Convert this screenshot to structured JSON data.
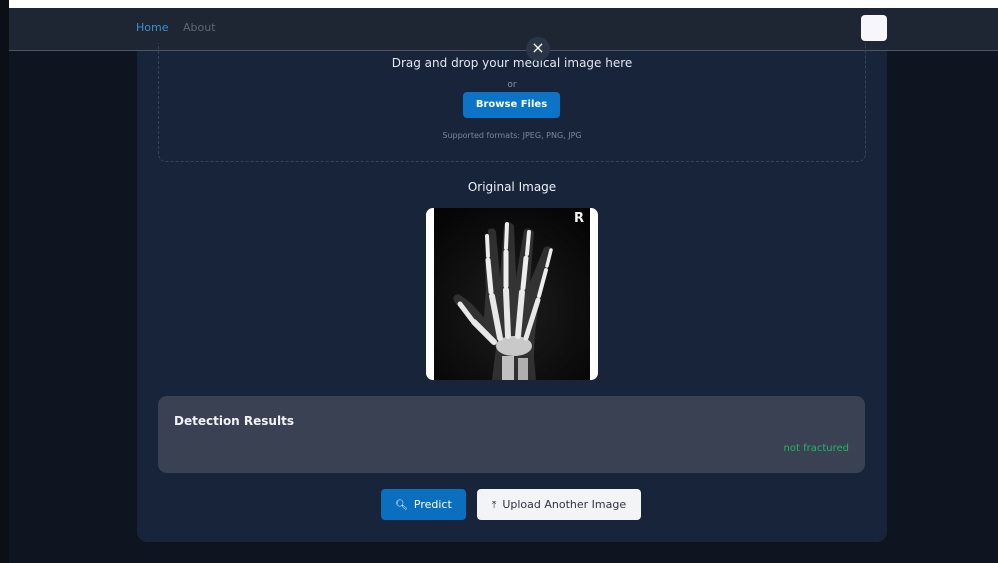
{
  "nav": {
    "home_label": "Home",
    "about_label": "About"
  },
  "dropzone": {
    "title": "Drag and drop your medical image here",
    "or_text": "or",
    "browse_label": "Browse Files",
    "formats_text": "Supported formats: JPEG, PNG, JPG",
    "close_glyph": "×"
  },
  "image_section": {
    "title": "Original Image",
    "marker_letter": "R"
  },
  "results": {
    "title": "Detection Results",
    "status": "not fractured"
  },
  "actions": {
    "predict_label": "Predict",
    "predict_icon": "search-icon",
    "upload_label": "Upload Another Image",
    "upload_icon": "upload-icon"
  },
  "colors": {
    "accent": "#0b74c6",
    "status_ok": "#29b45f",
    "card_bg": "#17243a",
    "navbar_bg": "#1e2634"
  }
}
